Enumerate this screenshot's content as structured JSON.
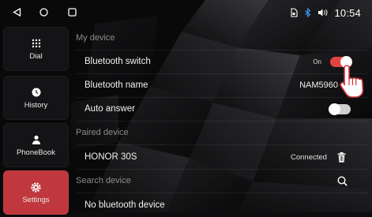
{
  "status_bar": {
    "time": "10:54",
    "icons": [
      "back-triangle-icon",
      "home-circle-icon",
      "recents-square-icon",
      "sim-icon",
      "bluetooth-icon",
      "volume-icon"
    ]
  },
  "sidebar": {
    "items": [
      {
        "label": "Dial",
        "icon": "dialpad-icon",
        "active": false
      },
      {
        "label": "History",
        "icon": "clock-icon",
        "active": false
      },
      {
        "label": "PhoneBook",
        "icon": "person-icon",
        "active": false
      },
      {
        "label": "Settings",
        "icon": "gear-icon",
        "active": true
      }
    ]
  },
  "main": {
    "my_device": {
      "title": "My device",
      "bluetooth_switch": {
        "label": "Bluetooth switch",
        "state_text": "On",
        "on": true
      },
      "bluetooth_name": {
        "label": "Bluetooth name",
        "value": "NAM5960"
      },
      "auto_answer": {
        "label": "Auto answer",
        "on": false
      }
    },
    "paired_device": {
      "title": "Paired device",
      "devices": [
        {
          "name": "HONOR 30S",
          "status": "Connected"
        }
      ]
    },
    "search_device": {
      "title": "Search device",
      "empty_text": "No bluetooth device"
    }
  },
  "colors": {
    "accent": "#e3453e",
    "active_tab": "#c0383e",
    "toggle_off": "#cfcfcf"
  }
}
